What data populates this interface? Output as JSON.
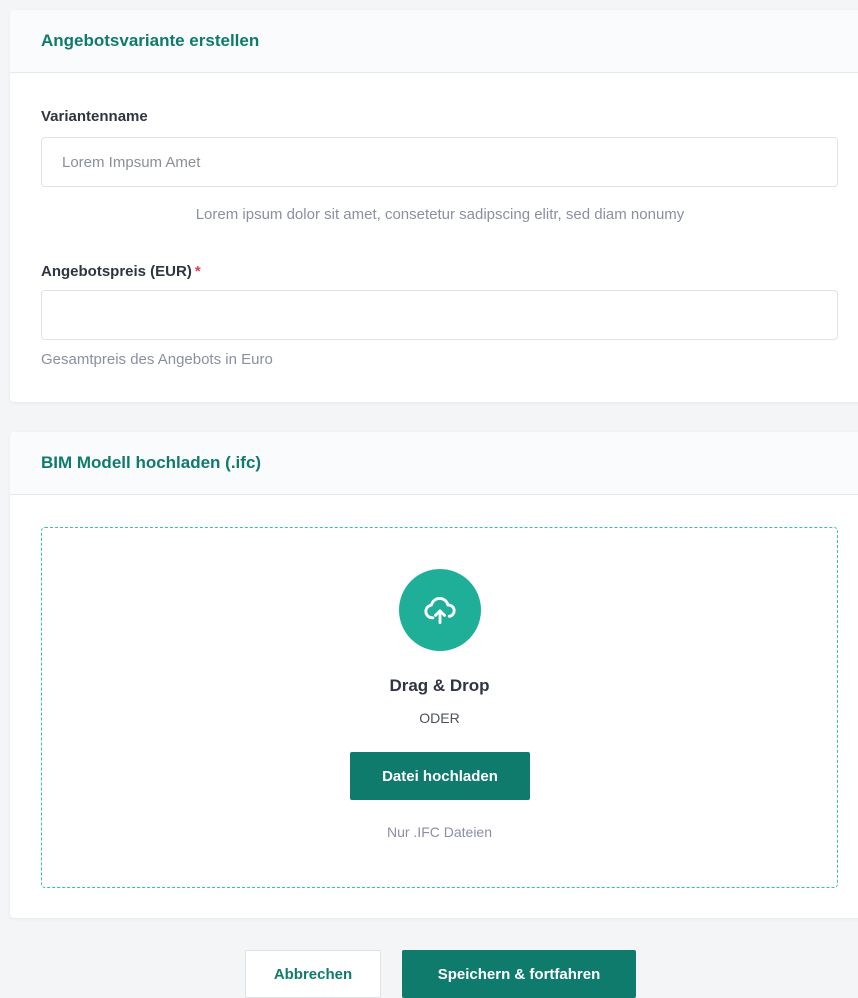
{
  "colors": {
    "accent": "#0f7b6c",
    "accent_light": "#1fae97",
    "required": "#e53950",
    "dropzone_border": "#37c1a9"
  },
  "variant_card": {
    "title": "Angebotsvariante erstellen",
    "name_label": "Variantenname",
    "name_placeholder": "Lorem Impsum Amet",
    "name_value": "",
    "description": "Lorem ipsum dolor sit amet, consetetur sadipscing elitr, sed diam nonumy",
    "price_label": "Angebotspreis (EUR)",
    "required_marker": "*",
    "price_value": "",
    "price_hint": "Gesamtpreis des Angebots in Euro"
  },
  "upload_card": {
    "title": "BIM Modell hochladen (.ifc)",
    "icon": "cloud-upload-icon",
    "drag_drop": "Drag & Drop",
    "or": "ODER",
    "upload_button": "Datei hochladen",
    "note": "Nur .IFC Dateien"
  },
  "actions": {
    "cancel": "Abbrechen",
    "save": "Speichern & fortfahren"
  }
}
